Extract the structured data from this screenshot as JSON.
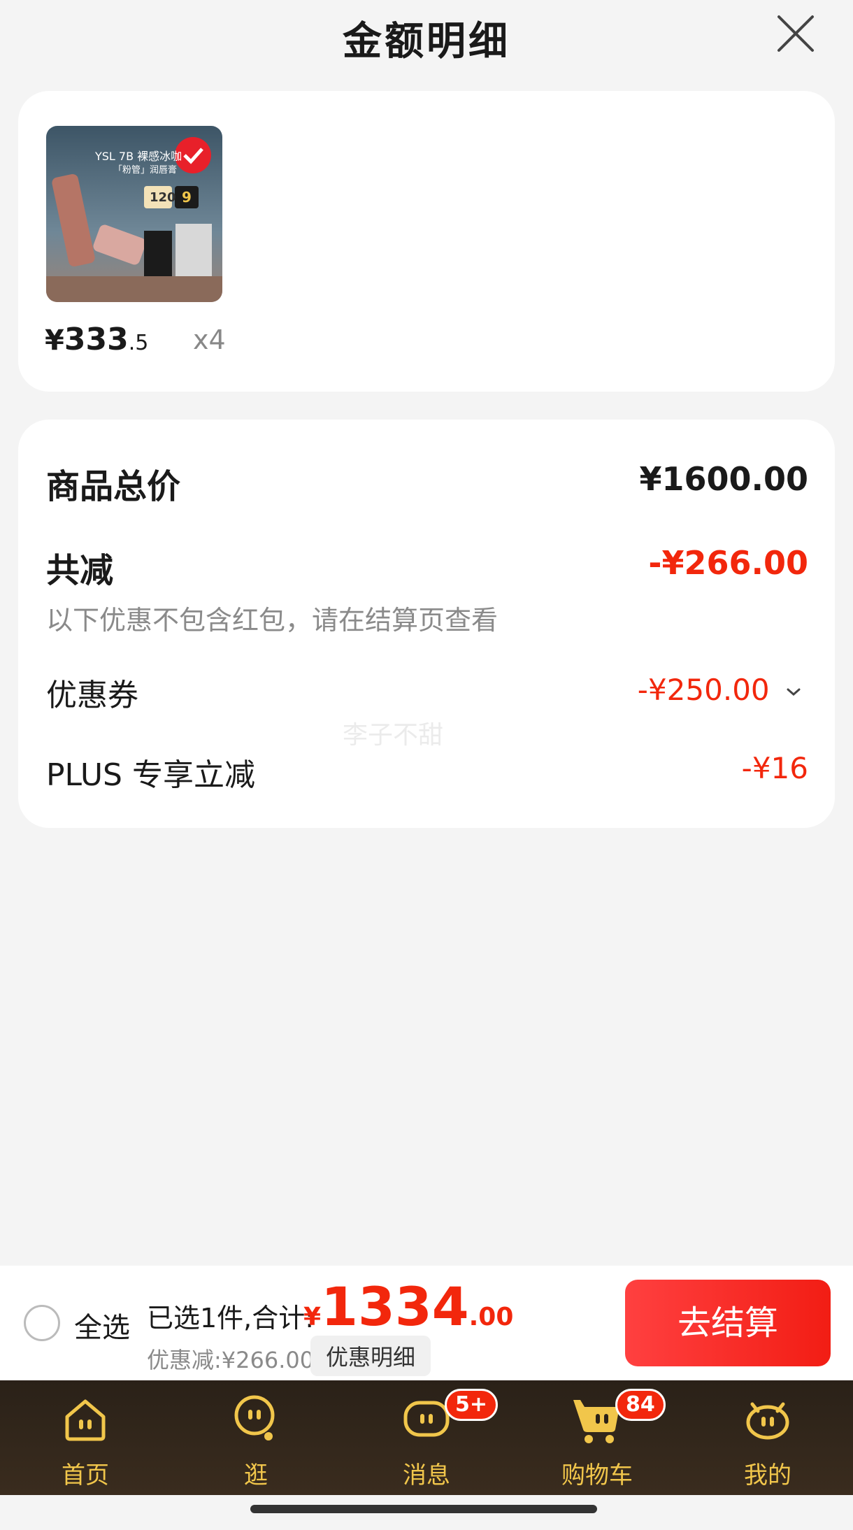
{
  "header": {
    "title": "金额明细"
  },
  "product": {
    "price_currency": "¥",
    "price_int": "333",
    "price_dec": ".5",
    "quantity": "x4",
    "thumb_lines": [
      "YSL 7B 裸感冰咖",
      "「粉管」润唇膏",
      "120",
      "9"
    ]
  },
  "summary": {
    "total_label": "商品总价",
    "total_value": "¥1600.00",
    "reduce_label": "共减",
    "reduce_value": "-¥266.00",
    "note": "以下优惠不包含红包，请在结算页查看",
    "coupon_label": "优惠券",
    "coupon_value": "-¥250.00",
    "plus_label": "PLUS 专享立减",
    "plus_value": "-¥16"
  },
  "watermark": "李子不甜",
  "checkout": {
    "select_all": "全选",
    "selected_text": "已选1件,合计:",
    "total_currency": "¥",
    "total_int": "1334",
    "total_dec": ".00",
    "discount_text": "优惠减:¥266.00",
    "detail_button": "优惠明细",
    "checkout_button": "去结算"
  },
  "tabs": [
    {
      "label": "首页",
      "icon": "home-icon"
    },
    {
      "label": "逛",
      "icon": "explore-icon"
    },
    {
      "label": "消息",
      "icon": "message-icon",
      "badge": "5+"
    },
    {
      "label": "购物车",
      "icon": "cart-icon",
      "badge": "84"
    },
    {
      "label": "我的",
      "icon": "profile-icon"
    }
  ],
  "colors": {
    "accent_red": "#f2270c",
    "tab_gold": "#f1c64b",
    "tab_bg": "#2a2118"
  }
}
